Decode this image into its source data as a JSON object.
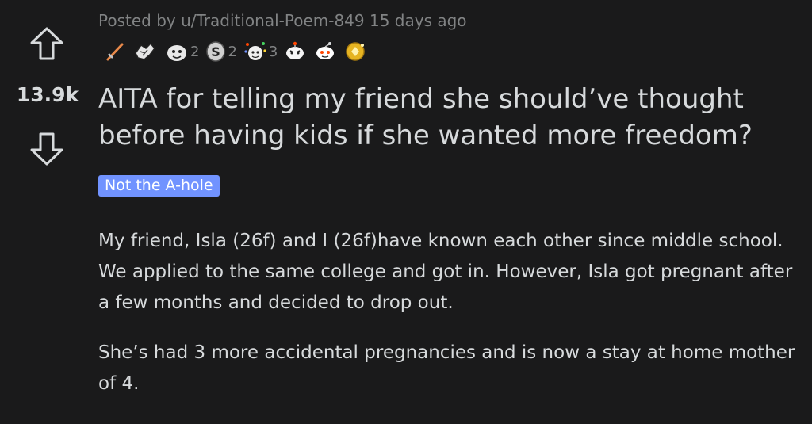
{
  "post": {
    "meta": "Posted by u/Traditional-Poem-849 15 days ago",
    "score": "13.9k",
    "title": "AITA for telling my friend she should’ve thought before having kids if she wanted more freedom?",
    "flair": "Not the A-hole",
    "body": [
      "My friend, Isla (26f) and I (26f)have known each other since middle school. We applied to the same college and got in. However, Isla got pregnant after a few months and decided to drop out.",
      "She’s had 3 more accidental pregnancies and is now a stay at home mother of 4."
    ],
    "awards": [
      {
        "icon": "sword-award-icon",
        "count": ""
      },
      {
        "icon": "hands-award-icon",
        "count": ""
      },
      {
        "icon": "face-award-icon",
        "count": "2"
      },
      {
        "icon": "coin-s-award-icon",
        "count": "2"
      },
      {
        "icon": "party-award-icon",
        "count": "3"
      },
      {
        "icon": "snoo-angry-award-icon",
        "count": ""
      },
      {
        "icon": "snoo-award-icon",
        "count": ""
      },
      {
        "icon": "gold-award-icon",
        "count": ""
      }
    ]
  },
  "colors": {
    "background": "#1a1a1b",
    "text": "#d7dadc",
    "meta": "#818384",
    "flair": "#7193ff"
  }
}
